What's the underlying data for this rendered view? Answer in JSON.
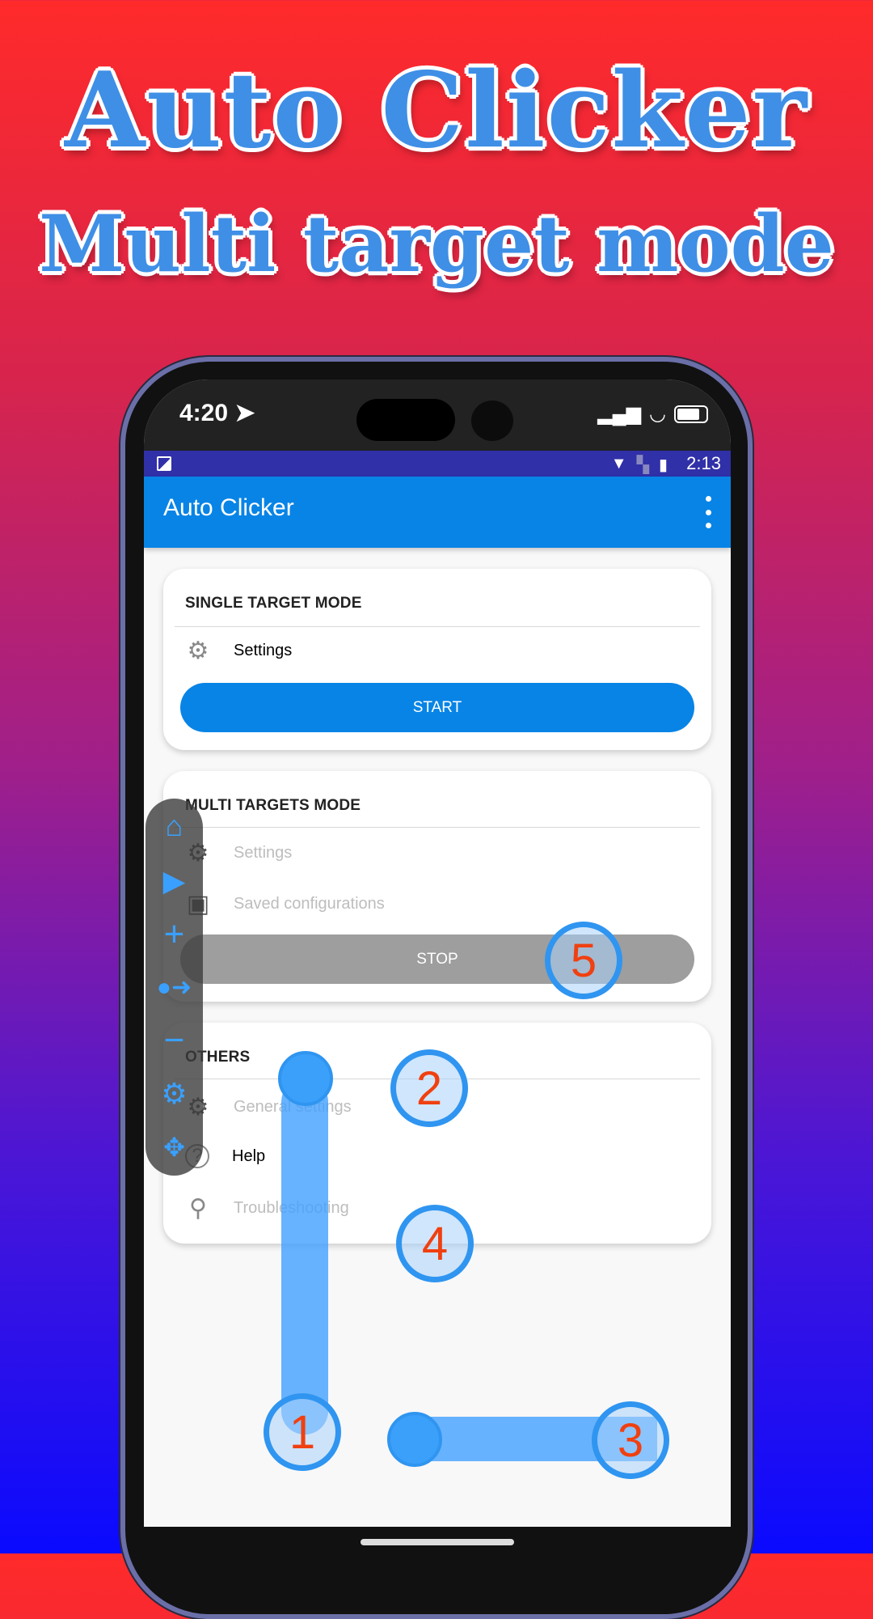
{
  "headline": {
    "line1": "Auto Clicker",
    "line2": "Multi target mode"
  },
  "ios_status": {
    "time": "4:20"
  },
  "android_status": {
    "time": "2:13"
  },
  "appbar": {
    "title": "Auto Clicker"
  },
  "single": {
    "title": "SINGLE TARGET MODE",
    "settings": "Settings",
    "start": "START"
  },
  "multi": {
    "title": "MULTI TARGETS MODE",
    "settings": "Settings",
    "saved": "Saved configurations",
    "stop": "STOP"
  },
  "others": {
    "title": "OTHERS",
    "general": "General settings",
    "help": "Help",
    "troubleshooting": "Troubleshooting"
  },
  "targets": [
    "1",
    "2",
    "3",
    "4",
    "5"
  ],
  "colors": {
    "accent": "#0884e6",
    "status_bar": "#3030a8",
    "target_ring": "#2f95f0",
    "target_number": "#f04010",
    "stop_button": "#9e9e9e"
  }
}
